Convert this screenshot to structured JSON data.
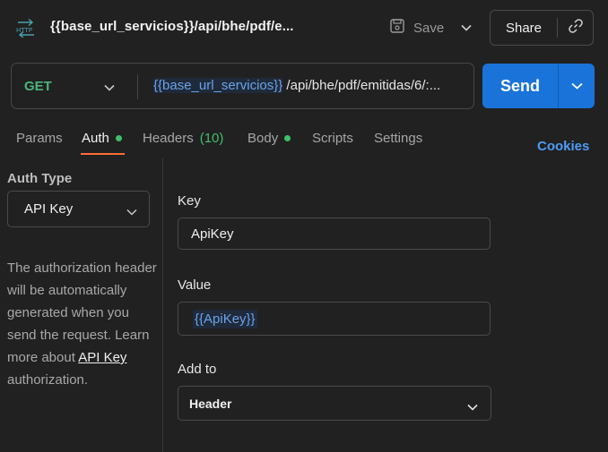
{
  "header": {
    "protocol_icon": "http-icon",
    "title": "{{base_url_servicios}}/api/bhe/pdf/e...",
    "save_label": "Save",
    "share_label": "Share"
  },
  "request": {
    "method": "GET",
    "url_variable": "{{base_url_servicios}}",
    "url_rest": " /api/bhe/pdf/emitidas/6/:...",
    "send_label": "Send"
  },
  "tabs": [
    {
      "label": "Params"
    },
    {
      "label": "Auth"
    },
    {
      "label": "Headers",
      "count": "(10)"
    },
    {
      "label": "Body"
    },
    {
      "label": "Scripts"
    },
    {
      "label": "Settings"
    }
  ],
  "cookies_label": "Cookies",
  "auth": {
    "type_label": "Auth Type",
    "type_value": "API Key",
    "help_text": "The authorization header will be automatically generated when you send the request. Learn more about",
    "help_link": "API Key",
    "help_suffix": "authorization."
  },
  "fields": {
    "key_label": "Key",
    "key_value": "ApiKey",
    "value_label": "Value",
    "value_value": "{{ApiKey}}",
    "add_to_label": "Add to",
    "add_to_value": "Header"
  },
  "colors": {
    "background": "#212121",
    "method_get": "#4cb57a",
    "send_button": "#1a73d9",
    "active_tab_underline": "#ff6c37",
    "status_dot": "#3fbf6a",
    "variable": "#6ba2ea",
    "cookies_link": "#4d9cf5"
  }
}
